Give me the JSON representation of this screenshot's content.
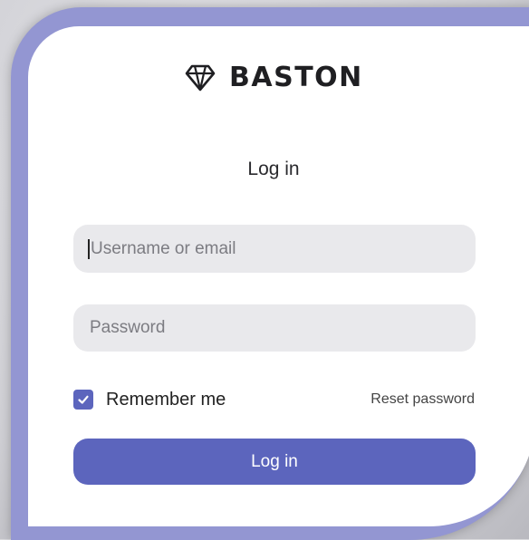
{
  "brand": {
    "name": "BASTON",
    "icon": "diamond-icon"
  },
  "form": {
    "title": "Log in",
    "username_placeholder": "Username or email",
    "password_placeholder": "Password",
    "remember_label": "Remember me",
    "remember_checked": true,
    "reset_label": "Reset password",
    "submit_label": "Log in"
  },
  "colors": {
    "accent": "#5c65bd",
    "frame": "#9396d2",
    "field_bg": "#e9e9ec"
  }
}
